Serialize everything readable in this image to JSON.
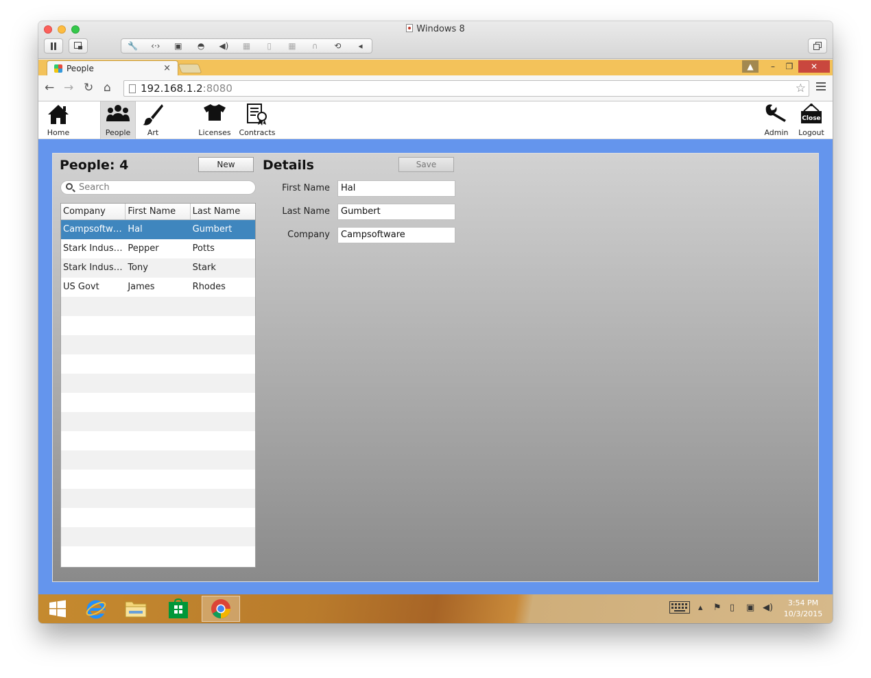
{
  "host_window": {
    "title": "Windows 8"
  },
  "browser": {
    "tab_title": "People",
    "tab_close": "×",
    "url_host": "192.168.1.2",
    "url_port": ":8080",
    "window_user": "▲",
    "window_min": "–",
    "window_max": "❐",
    "window_close": "✕"
  },
  "app_nav": {
    "items": [
      {
        "label": "Home",
        "icon": "home-icon"
      },
      {
        "label": "People",
        "icon": "people-icon",
        "active": true
      },
      {
        "label": "Art",
        "icon": "paintbrush-icon"
      },
      {
        "label": "Licenses",
        "icon": "tshirt-icon"
      },
      {
        "label": "Contracts",
        "icon": "contract-icon"
      },
      {
        "label": "Admin",
        "icon": "wrench-icon"
      },
      {
        "label": "Logout",
        "icon": "close-sign-icon",
        "sign_text": "Close"
      }
    ]
  },
  "people": {
    "title": "People: 4",
    "new_button": "New",
    "search_placeholder": "Search",
    "columns": [
      "Company",
      "First Name",
      "Last Name"
    ],
    "rows": [
      {
        "company": "Campsoftware",
        "first": "Hal",
        "last": "Gumbert",
        "selected": true
      },
      {
        "company": "Stark Industri...",
        "first": "Pepper",
        "last": "Potts"
      },
      {
        "company": "Stark Industri...",
        "first": "Tony",
        "last": "Stark"
      },
      {
        "company": "US Govt",
        "first": "James",
        "last": "Rhodes"
      }
    ]
  },
  "details": {
    "title": "Details",
    "save_button": "Save",
    "fields": {
      "first_name_label": "First Name",
      "first_name_value": "Hal",
      "last_name_label": "Last Name",
      "last_name_value": "Gumbert",
      "company_label": "Company",
      "company_value": "Campsoftware"
    }
  },
  "taskbar": {
    "time": "3:54 PM",
    "date": "10/3/2015"
  },
  "colors": {
    "frame_blue": "#6495ed",
    "selected_row": "#3f86be",
    "chrome_tabstrip": "#f3c25a"
  }
}
